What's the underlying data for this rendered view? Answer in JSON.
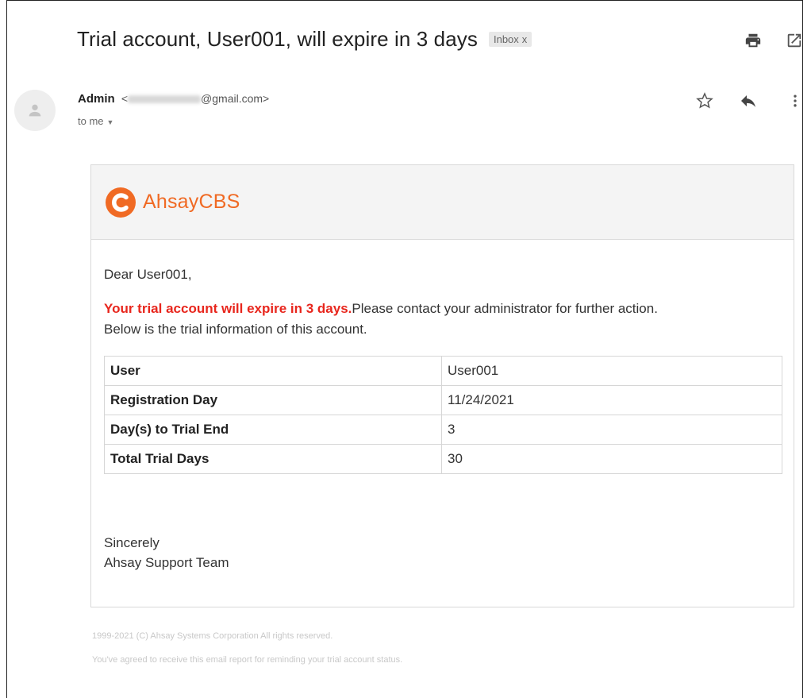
{
  "subject": "Trial account, User001, will expire in 3 days",
  "label": "Inbox",
  "label_close": "x",
  "icons": [
    "print-icon",
    "open-in-new-window-icon",
    "avatar-person-icon",
    "star-icon",
    "reply-icon",
    "more-vert-icon",
    "caret-down-icon",
    "ahsay-logo-icon"
  ],
  "sender": {
    "name": "Admin",
    "email_prefix": "<",
    "email_suffix": "@gmail.com>",
    "recipient": "to me"
  },
  "brand": {
    "name": "AhsayCBS",
    "color": "#f06a24"
  },
  "body": {
    "greeting": "Dear User001,",
    "warning": "Your trial account will expire in 3 days.",
    "warning_color": "#e8261d",
    "message": "Please contact your administrator for further action.",
    "line2": "Below is the trial information of this account.",
    "table": [
      {
        "key": "User",
        "value": "User001"
      },
      {
        "key": "Registration Day",
        "value": "11/24/2021"
      },
      {
        "key": "Day(s) to Trial End",
        "value": "3"
      },
      {
        "key": "Total Trial Days",
        "value": "30"
      }
    ],
    "closing": "Sincerely",
    "signature": "Ahsay Support Team"
  },
  "footer": {
    "copyright": "1999-2021 (C) Ahsay Systems Corporation All rights reserved.",
    "notice": "You've agreed to receive this email report for reminding your trial account status."
  }
}
